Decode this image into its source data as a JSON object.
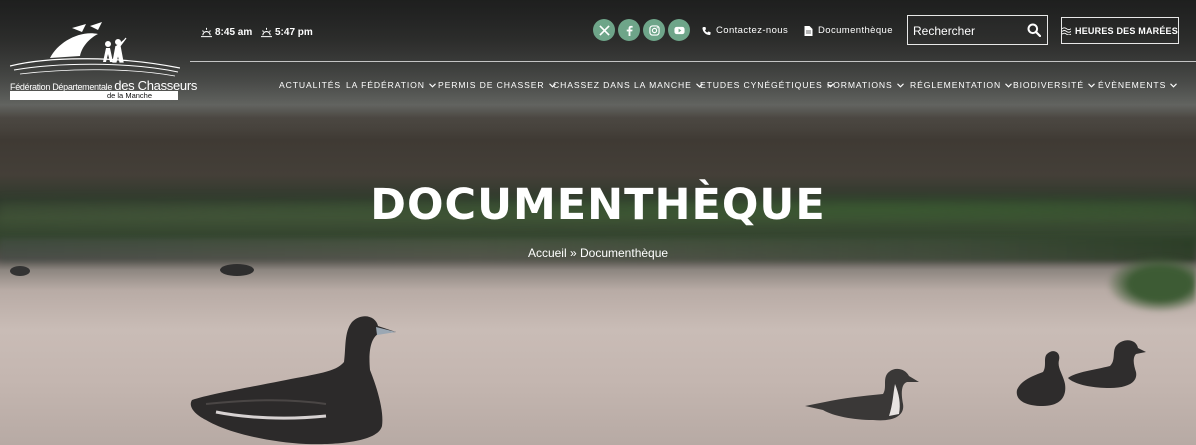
{
  "header": {
    "logo": {
      "line1_prefix": "Fédération Départementale ",
      "line1_suffix": "des Chasseurs",
      "line2": "de la Manche"
    },
    "times": [
      {
        "icon": "sunrise-icon",
        "label": "8:45 am"
      },
      {
        "icon": "sunset-icon",
        "label": "5:47 pm"
      }
    ],
    "social": [
      {
        "icon": "x-icon"
      },
      {
        "icon": "facebook-icon"
      },
      {
        "icon": "instagram-icon"
      },
      {
        "icon": "youtube-icon"
      }
    ],
    "links": {
      "contact": "Contactez-nous",
      "documents": "Documenthèque"
    },
    "search": {
      "placeholder": "Rechercher",
      "value": ""
    },
    "tides_button": "HEURES DES MARÉES"
  },
  "nav": [
    {
      "label": "ACTUALITÉS",
      "dropdown": false
    },
    {
      "label": "LA FÉDÉRATION",
      "dropdown": true
    },
    {
      "label": "PERMIS DE CHASSER",
      "dropdown": true
    },
    {
      "label": "CHASSEZ DANS LA MANCHE",
      "dropdown": true
    },
    {
      "label": "ETUDES CYNÉGÉTIQUES",
      "dropdown": true
    },
    {
      "label": "FORMATIONS",
      "dropdown": true
    },
    {
      "label": "RÉGLEMENTATION",
      "dropdown": true
    },
    {
      "label": "BIODIVERSITÉ",
      "dropdown": true
    },
    {
      "label": "ÉVÈNEMENTS",
      "dropdown": true
    }
  ],
  "hero": {
    "title": "DOCUMENTHÈQUE",
    "breadcrumb": {
      "home": "Accueil",
      "separator": "»",
      "current": "Documenthèque"
    }
  },
  "colors": {
    "social_bg": "#6ea589",
    "text": "#ffffff"
  }
}
